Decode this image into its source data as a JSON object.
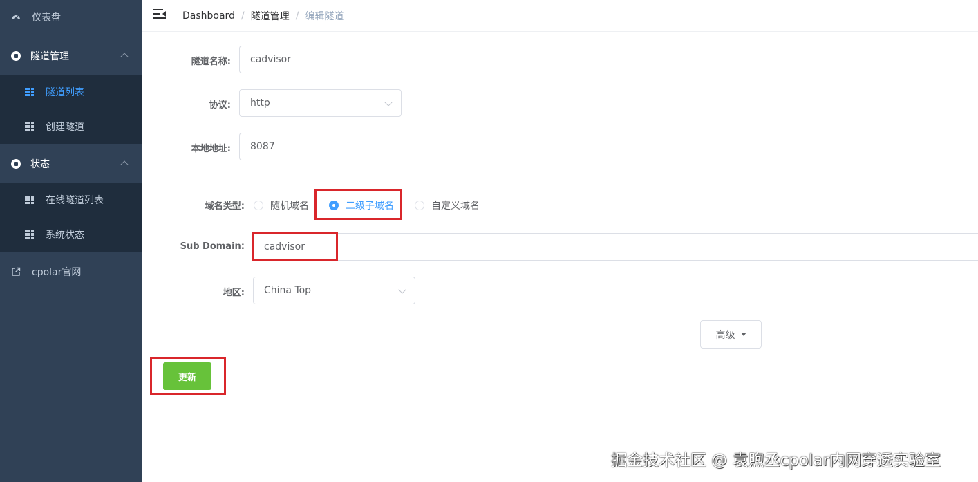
{
  "sidebar": {
    "dashboard": {
      "label": "仪表盘",
      "icon": "dashboard-icon"
    },
    "tunnel_mgmt": {
      "label": "隧道管理",
      "icon": "circle-icon"
    },
    "tunnel_list": {
      "label": "隧道列表",
      "icon": "table-icon"
    },
    "create_tunnel": {
      "label": "创建隧道",
      "icon": "table-icon"
    },
    "status": {
      "label": "状态",
      "icon": "circle-icon"
    },
    "online_tunnels": {
      "label": "在线隧道列表",
      "icon": "table-icon"
    },
    "system_status": {
      "label": "系统状态",
      "icon": "table-icon"
    },
    "website": {
      "label": "cpolar官网",
      "icon": "external-link-icon"
    }
  },
  "breadcrumb": {
    "home": "Dashboard",
    "parent": "隧道管理",
    "current": "编辑隧道",
    "separator": "/"
  },
  "form": {
    "name_label": "隧道名称:",
    "name_value": "cadvisor",
    "protocol_label": "协议:",
    "protocol_value": "http",
    "local_addr_label": "本地地址:",
    "local_addr_value": "8087",
    "domain_type_label": "域名类型:",
    "domain_options": [
      "随机域名",
      "二级子域名",
      "自定义域名"
    ],
    "domain_selected": "二级子域名",
    "subdomain_label": "Sub Domain:",
    "subdomain_value": "cadvisor",
    "region_label": "地区:",
    "region_value": "China Top",
    "advanced_button": "高级",
    "update_button": "更新"
  },
  "watermark": "掘金技术社区 @ 袁煦丞cpolar内网穿透实验室",
  "colors": {
    "sidebar_bg": "#304156",
    "submenu_bg": "#1f2d3d",
    "active": "#409eff",
    "primary_green": "#67c23a",
    "highlight_red": "#d9262b"
  }
}
